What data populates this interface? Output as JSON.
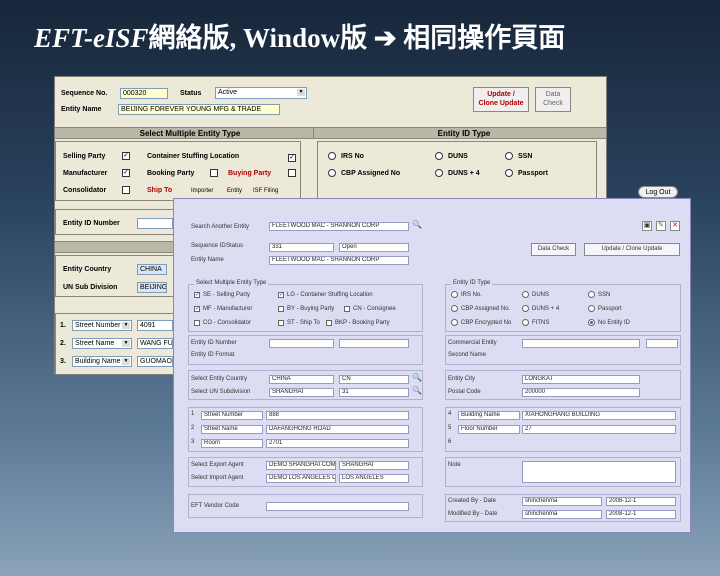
{
  "slide": {
    "title_a": "EFT-eISF",
    "title_b": "網絡版, Window版 ➔ 相同操作頁面"
  },
  "legacy": {
    "seq_label": "Sequence No.",
    "seq_value": "000320",
    "status_label": "Status",
    "status_value": "Active",
    "entity_name_label": "Entity Name",
    "entity_name_value": "BEIJING FOREVER YOUNG MFG & TRADE",
    "update_btn_line1": "Update /",
    "update_btn_line2": "Clone Update",
    "data_check_line1": "Data",
    "data_check_line2": "Check",
    "select_multi_bar": "Select Multiple Entity Type",
    "entity_id_bar": "Entity ID Type",
    "selling_party": "Selling Party",
    "container_stuffing": "Container Stuffing Location",
    "manufacturer": "Manufacturer",
    "booking_party": "Booking Party",
    "buying_party": "Buying Party",
    "consolidator": "Consolidator",
    "ship_to": "Ship To",
    "importer": "Importer",
    "entity": "Entity",
    "isf_filing": "ISF Filing",
    "irs_no": "IRS No",
    "duns": "DUNS",
    "ssn": "SSN",
    "cbp_assigned": "CBP Assigned No",
    "duns4": "DUNS + 4",
    "passport": "Passport",
    "entity_id_number": "Entity ID Number",
    "entity_country_label": "Entity Country",
    "entity_country_value": "CHINA",
    "un_sub_label": "UN Sub Division",
    "un_sub_value": "BEIJING",
    "row1_num": "1.",
    "row1_type": "Street Number",
    "row1_value": "4091",
    "row2_num": "2.",
    "row2_type": "Street Name",
    "row2_value": "WANG FU",
    "row3_num": "3.",
    "row3_type": "Building Name",
    "row3_value": "GUOMAO",
    "logout": "Log Out"
  },
  "web": {
    "search_label": "Search Another Entity",
    "search_value": "FLEETWOOD MAC - SHANNON CORP",
    "seq_label": "Sequence ID",
    "status_label": "Status",
    "seq_value": "331",
    "status_value": "Open",
    "entity_name_label": "Entity Name",
    "entity_name_value": "FLEETWOOD MAC - SHANNON CORP",
    "data_check_btn": "Data Check",
    "update_btn": "Update / Clone Update",
    "legend_multi": "Select Multiple Entity Type",
    "legend_id": "Entity ID Type",
    "se": "SE - Selling Party",
    "ls": "LG - Container Stuffing Location",
    "mf": "MF - Manufacturer",
    "by": "BY - Buying Party",
    "cn": "CN - Consignee",
    "co": "CO - Consolidator",
    "st": "ST - Ship To",
    "bkp": "BKP - Booking Party",
    "irs": "IRS No.",
    "duns": "DUNS",
    "ssn": "SSN",
    "cbp": "CBP Assigned No.",
    "duns4": "DUNS + 4",
    "passport": "Passport",
    "cbp_enc": "CBP Encrypted No",
    "fitns": "FITNS",
    "no_entity": "No Entity ID",
    "entity_id_number": "Entity ID Number",
    "entity_id_format": "Entity ID Format",
    "commercial_entity": "Commercial Entity",
    "second_name": "Second Name",
    "select_country": "Select Entity Country",
    "country_value": "CHINA",
    "country_code": "CN",
    "select_un": "Select UN Subdivision",
    "un_value": "SHANGHAI",
    "un_code": "31",
    "entity_city": "Entity City",
    "city_value": "LONGKAT",
    "postal_code": "Postal Code",
    "postal_value": "200000",
    "r1": "1",
    "r1_type": "Street Number",
    "r1_value": "888",
    "r2": "2",
    "r2_type": "Street Name",
    "r2_value": "DAFANGHONG ROAD",
    "r3": "3",
    "r3_type": "Room",
    "r3_value": "2701",
    "r4": "4",
    "r4_type": "Building Name",
    "r4_value": "XIAHONGHANG BUILDING",
    "r5": "5",
    "r5_type": "Floor Number",
    "r5_value": "27",
    "r6": "6",
    "export_agent": "Select Export Agent",
    "export_value": "DEMO SHANGHAI COMPANY",
    "export_code": "SHANGHAI",
    "import_agent": "Select Import Agent",
    "import_value": "DEMO LOS ANGELES COMPANY",
    "import_code": "LOS ANGELES",
    "note": "Note",
    "vendor_code": "EFT Vendor Code",
    "created_by": "Created By - Date",
    "created_user": "shinchenma",
    "created_date": "2008-12-1",
    "modified_by": "Modified By - Date",
    "modified_user": "shinchenma",
    "modified_date": "2008-12-1"
  }
}
